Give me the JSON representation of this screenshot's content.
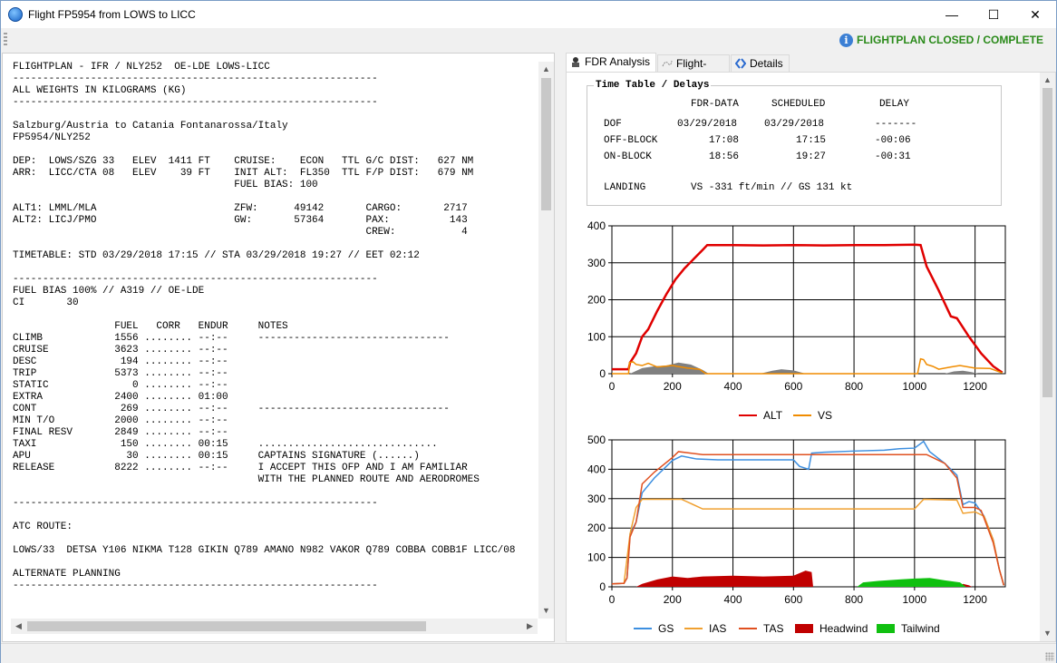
{
  "window": {
    "title": "Flight FP5954 from LOWS to LICC",
    "minimize": "—",
    "maximize": "☐",
    "close": "✕"
  },
  "toolbar": {
    "status": "FLIGHTPLAN CLOSED / COMPLETE",
    "status_color": "#2a8a1a",
    "info_glyph": "i"
  },
  "flightplan_text": "FLIGHTPLAN - IFR / NLY252  OE-LDE LOWS-LICC\n-------------------------------------------------------------\nALL WEIGHTS IN KILOGRAMS (KG)\n-------------------------------------------------------------\n\nSalzburg/Austria to Catania Fontanarossa/Italy\nFP5954/NLY252\n\nDEP:  LOWS/SZG 33   ELEV  1411 FT    CRUISE:    ECON   TTL G/C DIST:   627 NM\nARR:  LICC/CTA 08   ELEV    39 FT    INIT ALT:  FL350  TTL F/P DIST:   679 NM\n                                     FUEL BIAS: 100\n\nALT1: LMML/MLA                       ZFW:      49142       CARGO:       2717\nALT2: LICJ/PMO                       GW:       57364       PAX:          143\n                                                           CREW:           4\n\nTIMETABLE: STD 03/29/2018 17:15 // STA 03/29/2018 19:27 // EET 02:12\n\n-------------------------------------------------------------\nFUEL BIAS 100% // A319 // OE-LDE\nCI       30\n\n                 FUEL   CORR   ENDUR     NOTES\nCLIMB            1556 ........ --:--     --------------------------------\nCRUISE           3623 ........ --:--\nDESC              194 ........ --:--\nTRIP             5373 ........ --:--\nSTATIC              0 ........ --:--\nEXTRA            2400 ........ 01:00\nCONT              269 ........ --:--     --------------------------------\nMIN T/O          2000 ........ --:--\nFINAL RESV       2849 ........ --:--\nTAXI              150 ........ 00:15     ..............................\nAPU                30 ........ 00:15     CAPTAINS SIGNATURE (......)\nRELEASE          8222 ........ --:--     I ACCEPT THIS OFP AND I AM FAMILIAR\n                                         WITH THE PLANNED ROUTE AND AERODROMES\n\n-------------------------------------------------------------\n\nATC ROUTE:\n\nLOWS/33  DETSA Y106 NIKMA T128 GIKIN Q789 AMANO N982 VAKOR Q789 COBBA COBB1F LICC/08\n\nALTERNATE PLANNING\n-------------------------------------------------------------",
  "tabs": [
    {
      "label": "FDR Analysis",
      "icon": "pilot-icon",
      "active": true
    },
    {
      "label": "Flight-Path",
      "icon": "flight-path-icon",
      "active": false
    },
    {
      "label": "Details",
      "icon": "details-icon",
      "active": false
    }
  ],
  "timetable": {
    "title": "Time Table / Delays",
    "headers": [
      "FDR-DATA",
      "SCHEDULED",
      "DELAY"
    ],
    "rows": [
      {
        "label": "DOF",
        "fdr": "03/29/2018",
        "sched": "03/29/2018",
        "delay": "-------"
      },
      {
        "label": "OFF-BLOCK",
        "fdr": "17:08",
        "sched": "17:15",
        "delay": "-00:06"
      },
      {
        "label": "ON-BLOCK",
        "fdr": "18:56",
        "sched": "19:27",
        "delay": "-00:31"
      }
    ],
    "landing_label": "LANDING",
    "landing_value": "VS -331 ft/min // GS 131 kt"
  },
  "chart_data": [
    {
      "type": "line",
      "ylim": [
        0,
        400
      ],
      "xlim": [
        0,
        1300
      ],
      "yticks": [
        "0",
        "100",
        "200",
        "300",
        "400"
      ],
      "xticks": [
        "0",
        "200",
        "400",
        "600",
        "800",
        "1000",
        "1200"
      ],
      "grid": true,
      "legend_position": "bottom",
      "series": [
        {
          "name": "ALT",
          "color": "#e00000",
          "points": [
            [
              0,
              12
            ],
            [
              55,
              12
            ],
            [
              60,
              30
            ],
            [
              80,
              55
            ],
            [
              100,
              100
            ],
            [
              120,
              120
            ],
            [
              150,
              170
            ],
            [
              180,
              215
            ],
            [
              210,
              255
            ],
            [
              240,
              285
            ],
            [
              270,
              310
            ],
            [
              300,
              335
            ],
            [
              315,
              348
            ],
            [
              400,
              348
            ],
            [
              500,
              347
            ],
            [
              600,
              348
            ],
            [
              700,
              347
            ],
            [
              800,
              348
            ],
            [
              900,
              348
            ],
            [
              1000,
              349
            ],
            [
              1020,
              348
            ],
            [
              1040,
              290
            ],
            [
              1080,
              225
            ],
            [
              1120,
              155
            ],
            [
              1140,
              150
            ],
            [
              1180,
              100
            ],
            [
              1220,
              55
            ],
            [
              1260,
              20
            ],
            [
              1290,
              3
            ]
          ]
        },
        {
          "name": "VS",
          "color": "#f08c00",
          "points": [
            [
              0,
              0
            ],
            [
              55,
              0
            ],
            [
              58,
              30
            ],
            [
              70,
              32
            ],
            [
              80,
              25
            ],
            [
              100,
              22
            ],
            [
              120,
              28
            ],
            [
              150,
              18
            ],
            [
              200,
              22
            ],
            [
              250,
              15
            ],
            [
              290,
              12
            ],
            [
              310,
              0
            ],
            [
              1010,
              0
            ],
            [
              1020,
              40
            ],
            [
              1030,
              38
            ],
            [
              1040,
              25
            ],
            [
              1060,
              20
            ],
            [
              1080,
              12
            ],
            [
              1120,
              18
            ],
            [
              1150,
              22
            ],
            [
              1200,
              15
            ],
            [
              1250,
              14
            ],
            [
              1290,
              2
            ]
          ]
        }
      ],
      "areas": [
        {
          "color": "#808080",
          "points": [
            [
              60,
              0
            ],
            [
              100,
              15
            ],
            [
              140,
              20
            ],
            [
              180,
              22
            ],
            [
              220,
              30
            ],
            [
              260,
              25
            ],
            [
              300,
              10
            ],
            [
              320,
              0
            ]
          ]
        },
        {
          "color": "#808080",
          "points": [
            [
              490,
              0
            ],
            [
              530,
              8
            ],
            [
              560,
              12
            ],
            [
              600,
              9
            ],
            [
              640,
              0
            ]
          ]
        },
        {
          "color": "#808080",
          "points": [
            [
              1100,
              0
            ],
            [
              1130,
              6
            ],
            [
              1160,
              8
            ],
            [
              1190,
              4
            ],
            [
              1210,
              0
            ]
          ]
        }
      ]
    },
    {
      "type": "line",
      "ylim": [
        0,
        500
      ],
      "xlim": [
        0,
        1300
      ],
      "yticks": [
        "0",
        "100",
        "200",
        "300",
        "400",
        "500"
      ],
      "xticks": [
        "0",
        "200",
        "400",
        "600",
        "800",
        "1000",
        "1200"
      ],
      "grid": true,
      "legend_position": "bottom",
      "series": [
        {
          "name": "GS",
          "color": "#3d8fe0",
          "points": [
            [
              0,
              10
            ],
            [
              40,
              12
            ],
            [
              50,
              30
            ],
            [
              60,
              180
            ],
            [
              80,
              220
            ],
            [
              100,
              320
            ],
            [
              140,
              370
            ],
            [
              200,
              430
            ],
            [
              230,
              445
            ],
            [
              280,
              435
            ],
            [
              350,
              432
            ],
            [
              500,
              432
            ],
            [
              600,
              432
            ],
            [
              620,
              410
            ],
            [
              650,
              400
            ],
            [
              660,
              455
            ],
            [
              700,
              458
            ],
            [
              800,
              462
            ],
            [
              900,
              465
            ],
            [
              950,
              470
            ],
            [
              1000,
              472
            ],
            [
              1030,
              495
            ],
            [
              1050,
              460
            ],
            [
              1100,
              420
            ],
            [
              1140,
              380
            ],
            [
              1160,
              280
            ],
            [
              1180,
              290
            ],
            [
              1200,
              285
            ],
            [
              1230,
              240
            ],
            [
              1260,
              160
            ],
            [
              1280,
              60
            ],
            [
              1295,
              5
            ]
          ]
        },
        {
          "name": "IAS",
          "color": "#f0a030",
          "points": [
            [
              0,
              10
            ],
            [
              40,
              12
            ],
            [
              60,
              180
            ],
            [
              80,
              270
            ],
            [
              100,
              298
            ],
            [
              230,
              298
            ],
            [
              300,
              265
            ],
            [
              600,
              265
            ],
            [
              800,
              265
            ],
            [
              1000,
              265
            ],
            [
              1030,
              298
            ],
            [
              1140,
              295
            ],
            [
              1160,
              250
            ],
            [
              1200,
              255
            ],
            [
              1230,
              240
            ],
            [
              1260,
              160
            ],
            [
              1280,
              60
            ],
            [
              1295,
              5
            ]
          ]
        },
        {
          "name": "TAS",
          "color": "#e05020",
          "points": [
            [
              0,
              10
            ],
            [
              40,
              12
            ],
            [
              50,
              30
            ],
            [
              60,
              170
            ],
            [
              80,
              220
            ],
            [
              100,
              350
            ],
            [
              140,
              390
            ],
            [
              200,
              440
            ],
            [
              220,
              460
            ],
            [
              300,
              450
            ],
            [
              600,
              450
            ],
            [
              800,
              450
            ],
            [
              1000,
              450
            ],
            [
              1040,
              450
            ],
            [
              1100,
              420
            ],
            [
              1140,
              370
            ],
            [
              1160,
              270
            ],
            [
              1200,
              270
            ],
            [
              1220,
              260
            ],
            [
              1260,
              150
            ],
            [
              1280,
              60
            ],
            [
              1295,
              5
            ]
          ]
        }
      ],
      "areas": [
        {
          "name": "Headwind",
          "color": "#c00000",
          "points": [
            [
              80,
              0
            ],
            [
              100,
              10
            ],
            [
              150,
              25
            ],
            [
              200,
              35
            ],
            [
              250,
              30
            ],
            [
              300,
              35
            ],
            [
              400,
              38
            ],
            [
              500,
              35
            ],
            [
              600,
              38
            ],
            [
              640,
              55
            ],
            [
              660,
              50
            ],
            [
              665,
              0
            ]
          ]
        },
        {
          "name": "Headwind",
          "color": "#c00000",
          "points": [
            [
              1150,
              0
            ],
            [
              1160,
              10
            ],
            [
              1180,
              5
            ],
            [
              1190,
              0
            ]
          ]
        },
        {
          "name": "Tailwind",
          "color": "#10c010",
          "points": [
            [
              810,
              0
            ],
            [
              830,
              15
            ],
            [
              880,
              20
            ],
            [
              950,
              25
            ],
            [
              1000,
              28
            ],
            [
              1050,
              30
            ],
            [
              1100,
              22
            ],
            [
              1150,
              15
            ],
            [
              1170,
              0
            ]
          ]
        }
      ],
      "legend": [
        {
          "name": "GS",
          "color": "#3d8fe0",
          "kind": "line"
        },
        {
          "name": "IAS",
          "color": "#f0a030",
          "kind": "line"
        },
        {
          "name": "TAS",
          "color": "#e05020",
          "kind": "line"
        },
        {
          "name": "Headwind",
          "color": "#c00000",
          "kind": "box"
        },
        {
          "name": "Tailwind",
          "color": "#10c010",
          "kind": "box"
        }
      ]
    }
  ]
}
